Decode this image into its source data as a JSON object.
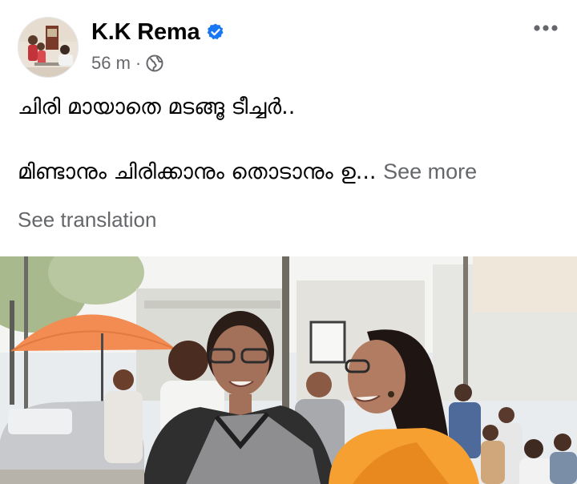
{
  "post": {
    "author": "K.K Rema",
    "time": "56 m",
    "separator": "·",
    "audience_icon": "globe-icon",
    "verified_icon": "verified-badge-icon",
    "more_icon": "more-options-icon",
    "text_line_1": "ചിരി മായാതെ മടങ്ങൂ ടീച്ചർ..",
    "text_line_2": "മിണ്ടാനും ചിരിക്കാനും തൊടാനും ഉ...",
    "see_more": "See more",
    "see_translation": "See translation"
  },
  "colors": {
    "verified": "#1877f2",
    "secondary_text": "#65676b",
    "umbrella": "#f28c52",
    "saffron_scarf": "#f5a030"
  }
}
